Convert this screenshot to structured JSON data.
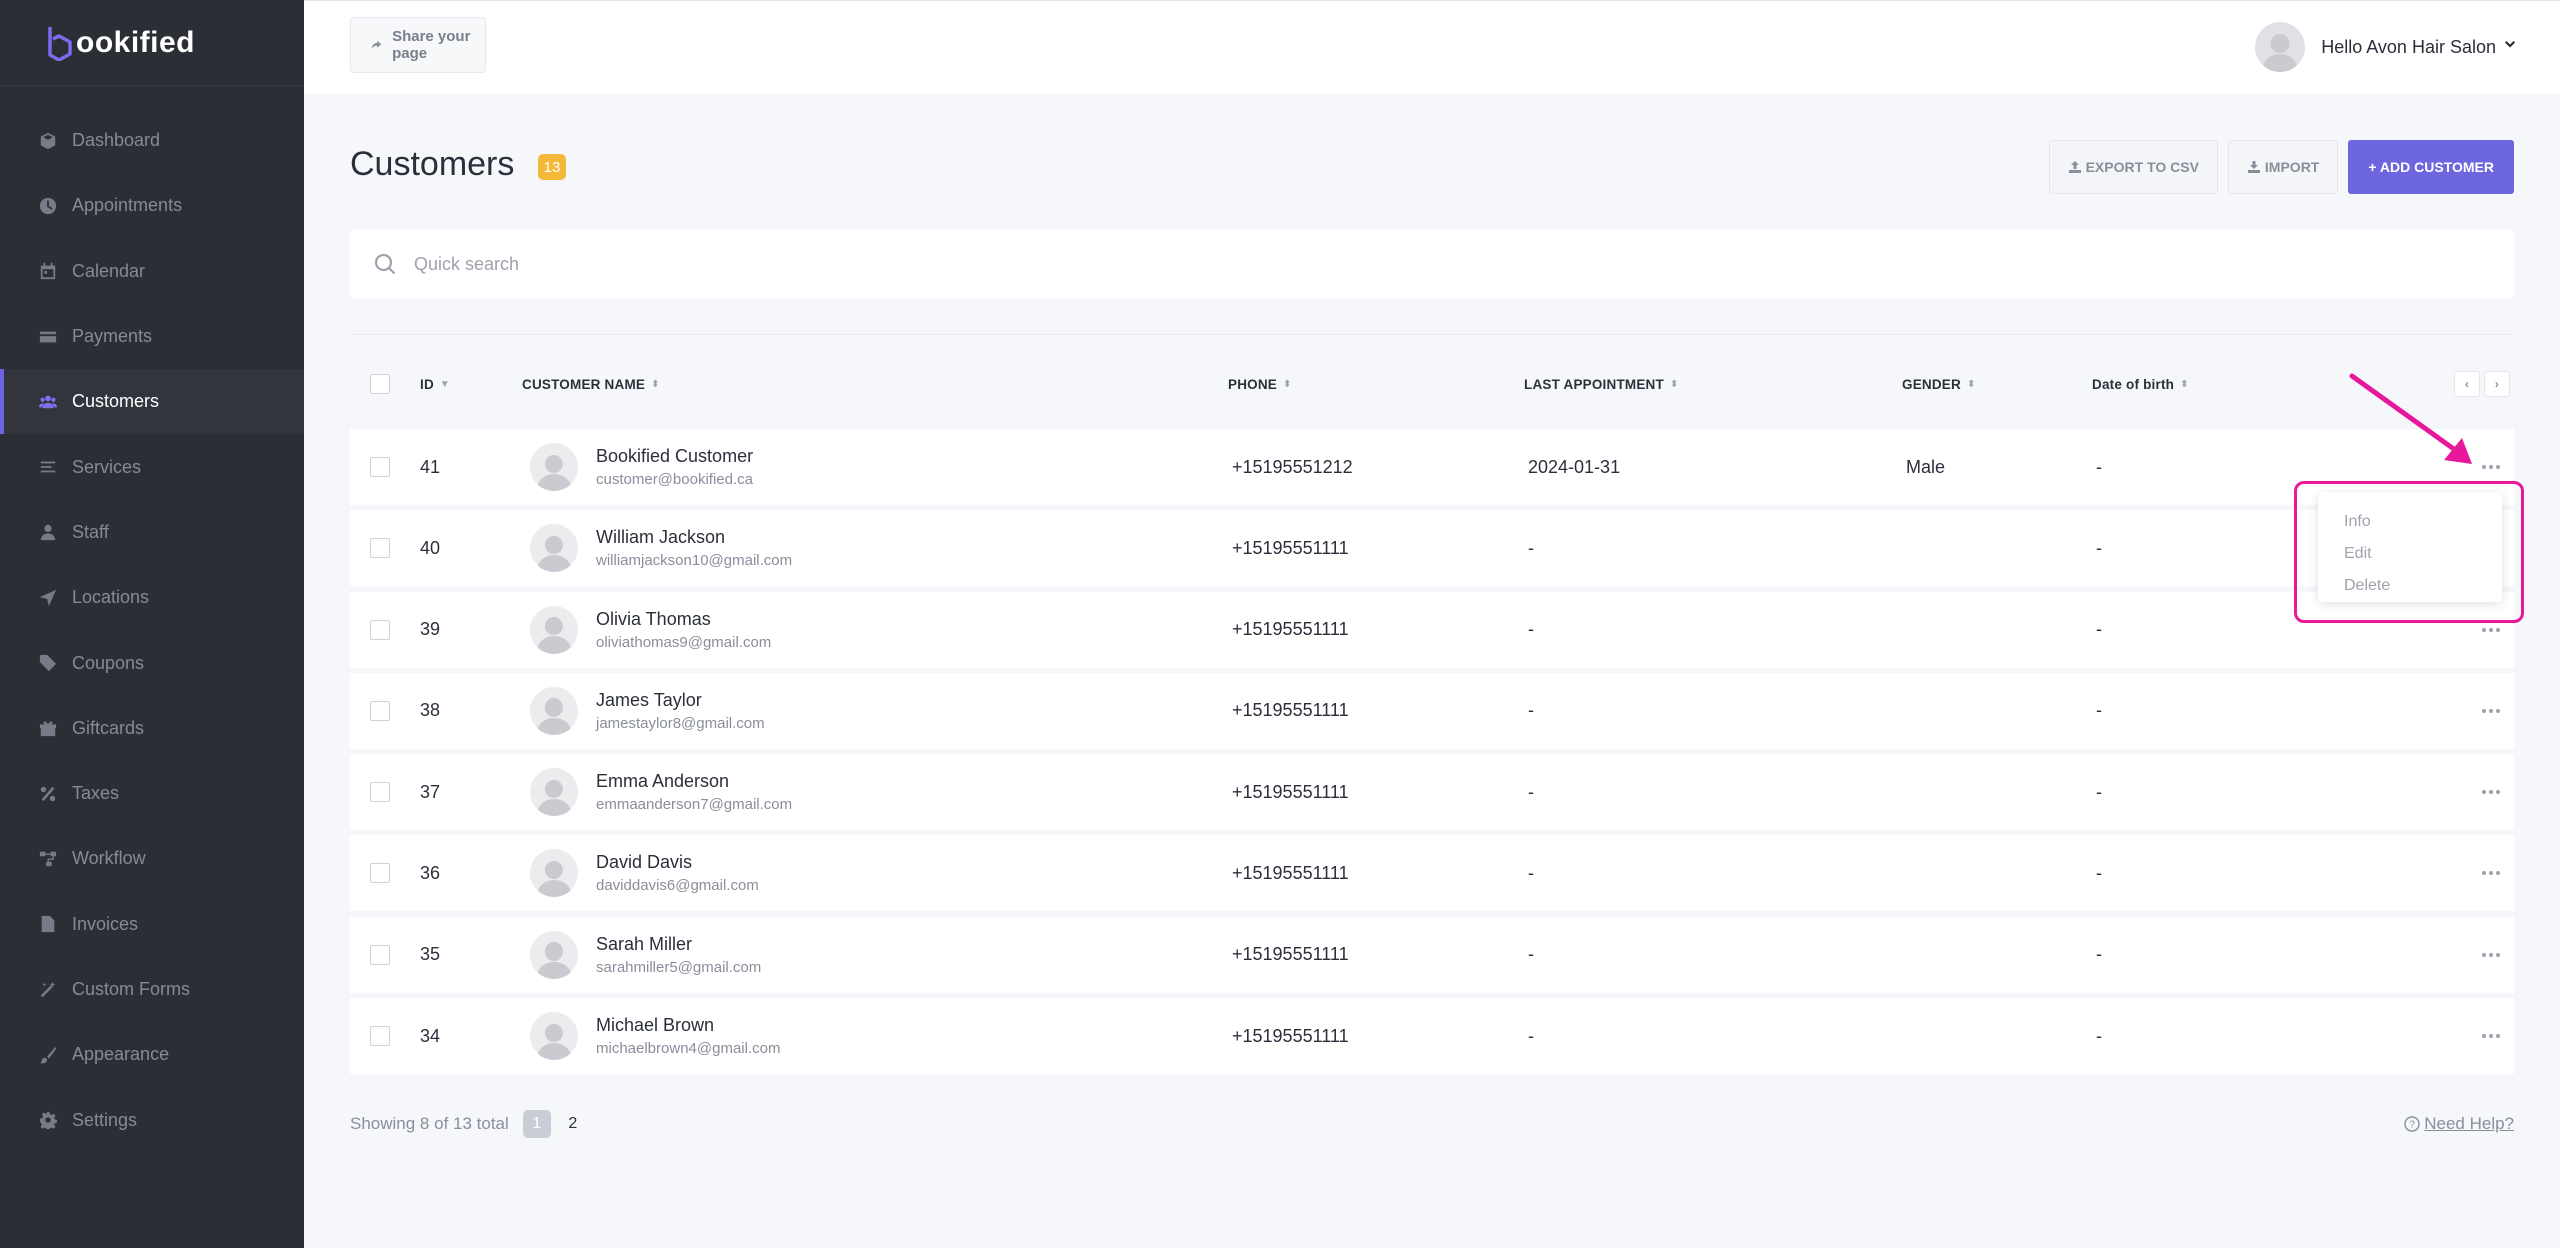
{
  "brand": {
    "logo_text": "ookified",
    "accent": "#6d66de"
  },
  "sidebar": {
    "items": [
      {
        "label": "Dashboard",
        "icon": "cube-icon",
        "active": false
      },
      {
        "label": "Appointments",
        "icon": "clock-icon",
        "active": false
      },
      {
        "label": "Calendar",
        "icon": "calendar-icon",
        "active": false
      },
      {
        "label": "Payments",
        "icon": "credit-card-icon",
        "active": false
      },
      {
        "label": "Customers",
        "icon": "users-icon",
        "active": true
      },
      {
        "label": "Services",
        "icon": "list-icon",
        "active": false
      },
      {
        "label": "Staff",
        "icon": "user-icon",
        "active": false
      },
      {
        "label": "Locations",
        "icon": "location-arrow-icon",
        "active": false
      },
      {
        "label": "Coupons",
        "icon": "tag-icon",
        "active": false
      },
      {
        "label": "Giftcards",
        "icon": "gift-icon",
        "active": false
      },
      {
        "label": "Taxes",
        "icon": "percent-icon",
        "active": false
      },
      {
        "label": "Workflow",
        "icon": "workflow-icon",
        "active": false
      },
      {
        "label": "Invoices",
        "icon": "file-icon",
        "active": false
      },
      {
        "label": "Custom Forms",
        "icon": "magic-wand-icon",
        "active": false
      },
      {
        "label": "Appearance",
        "icon": "paint-brush-icon",
        "active": false
      },
      {
        "label": "Settings",
        "icon": "gear-icon",
        "active": false
      }
    ]
  },
  "topbar": {
    "share_label": "Share your page",
    "user_greeting": "Hello Avon Hair Salon"
  },
  "page": {
    "title": "Customers",
    "count": "13",
    "export_label": "EXPORT TO CSV",
    "import_label": "IMPORT",
    "add_label": "+ ADD CUSTOMER"
  },
  "search": {
    "placeholder": "Quick search"
  },
  "table": {
    "columns": {
      "id": "ID",
      "name": "CUSTOMER NAME",
      "phone": "PHONE",
      "last": "LAST APPOINTMENT",
      "gender": "GENDER",
      "dob": "Date of birth"
    },
    "rows": [
      {
        "id": "41",
        "name": "Bookified Customer",
        "email": "customer@bookified.ca",
        "phone": "+15195551212",
        "last": "2024-01-31",
        "gender": "Male",
        "dob": "-"
      },
      {
        "id": "40",
        "name": "William Jackson",
        "email": "williamjackson10@gmail.com",
        "phone": "+15195551111",
        "last": "-",
        "gender": "",
        "dob": "-"
      },
      {
        "id": "39",
        "name": "Olivia Thomas",
        "email": "oliviathomas9@gmail.com",
        "phone": "+15195551111",
        "last": "-",
        "gender": "",
        "dob": "-"
      },
      {
        "id": "38",
        "name": "James Taylor",
        "email": "jamestaylor8@gmail.com",
        "phone": "+15195551111",
        "last": "-",
        "gender": "",
        "dob": "-"
      },
      {
        "id": "37",
        "name": "Emma Anderson",
        "email": "emmaanderson7@gmail.com",
        "phone": "+15195551111",
        "last": "-",
        "gender": "",
        "dob": "-"
      },
      {
        "id": "36",
        "name": "David Davis",
        "email": "daviddavis6@gmail.com",
        "phone": "+15195551111",
        "last": "-",
        "gender": "",
        "dob": "-"
      },
      {
        "id": "35",
        "name": "Sarah Miller",
        "email": "sarahmiller5@gmail.com",
        "phone": "+15195551111",
        "last": "-",
        "gender": "",
        "dob": "-"
      },
      {
        "id": "34",
        "name": "Michael Brown",
        "email": "michaelbrown4@gmail.com",
        "phone": "+15195551111",
        "last": "-",
        "gender": "",
        "dob": "-"
      }
    ]
  },
  "dropdown": {
    "info": "Info",
    "edit": "Edit",
    "delete": "Delete",
    "highlight_color": "#e8189c"
  },
  "footer": {
    "showing": "Showing 8 of 13 total",
    "page_current": "1",
    "page_next": "2",
    "help": "Need Help?"
  }
}
